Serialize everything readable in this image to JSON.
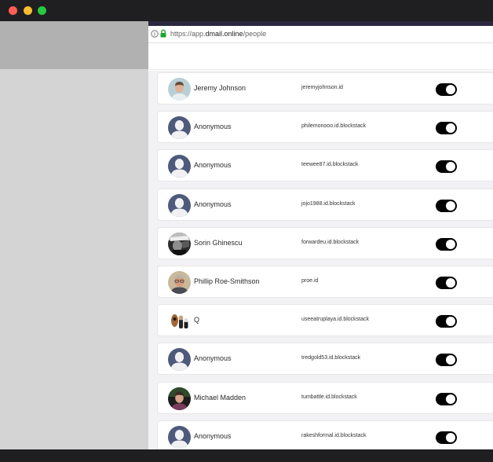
{
  "window": {
    "colors": {
      "close": "#ff5f57",
      "minimize": "#febc2e",
      "maximize": "#28c840"
    }
  },
  "browser": {
    "url_scheme": "https://app.",
    "url_host": "dmail.online",
    "url_path": "/people",
    "accent_color": "#2b2840"
  },
  "people": [
    {
      "name": "Jeremy Johnson",
      "handle": "jeremyjohnson.id",
      "enabled": true,
      "avatar": "photo-man-light"
    },
    {
      "name": "Anonymous",
      "handle": "philemonooo.id.blockstack",
      "enabled": true,
      "avatar": "default-person-icon"
    },
    {
      "name": "Anonymous",
      "handle": "teewee87.id.blockstack",
      "enabled": true,
      "avatar": "default-person-icon"
    },
    {
      "name": "Anonymous",
      "handle": "jojo1988.id.blockstack",
      "enabled": true,
      "avatar": "default-person-icon"
    },
    {
      "name": "Sorin Ghinescu",
      "handle": "forwardeu.id.blockstack",
      "enabled": true,
      "avatar": "photo-bw"
    },
    {
      "name": "Phillip Roe-Smithson",
      "handle": "proe.id",
      "enabled": true,
      "avatar": "photo-man-glasses"
    },
    {
      "name": "Q",
      "handle": "useeatruplaya.id.blockstack",
      "enabled": true,
      "avatar": "photo-figurines"
    },
    {
      "name": "Anonymous",
      "handle": "tredgold53.id.blockstack",
      "enabled": true,
      "avatar": "default-person-icon"
    },
    {
      "name": "Michael Madden",
      "handle": "tumbattle.id.blockstack",
      "enabled": true,
      "avatar": "photo-man-dark"
    },
    {
      "name": "Anonymous",
      "handle": "rakeshformal.id.blockstack",
      "enabled": true,
      "avatar": "default-person-icon"
    }
  ]
}
